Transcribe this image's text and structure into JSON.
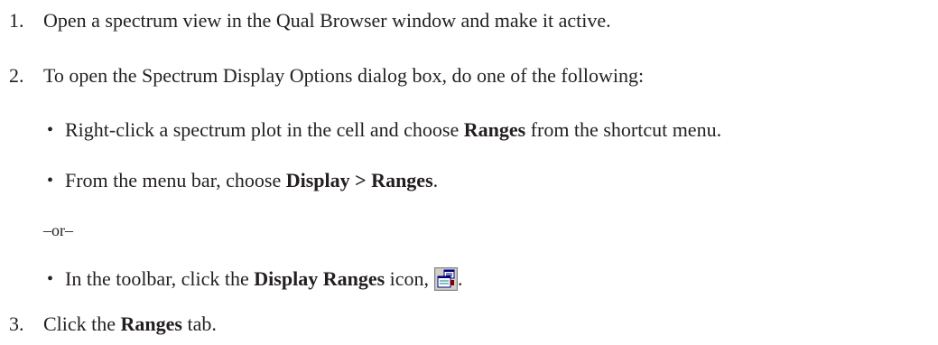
{
  "steps": [
    {
      "number": "1.",
      "text": "Open a spectrum view in the Qual Browser window and make it active."
    },
    {
      "number": "2.",
      "text": "To open the Spectrum Display Options dialog box, do one of the following:",
      "bullets": [
        {
          "pre": "Right-click a spectrum plot in the cell and choose ",
          "bold": "Ranges",
          "post": " from the shortcut menu."
        },
        {
          "pre": "From the menu bar, choose ",
          "bold": "Display > Ranges",
          "post": "."
        }
      ],
      "separator": "–or–",
      "bullets_after": [
        {
          "pre": "In the toolbar, click the ",
          "bold": "Display Ranges",
          "post": " icon,",
          "icon": "display-ranges-icon",
          "trailing": "."
        }
      ]
    },
    {
      "number": "3.",
      "pre": "Click the ",
      "bold": "Ranges",
      "post": " tab."
    }
  ],
  "bullet_glyph": "•"
}
